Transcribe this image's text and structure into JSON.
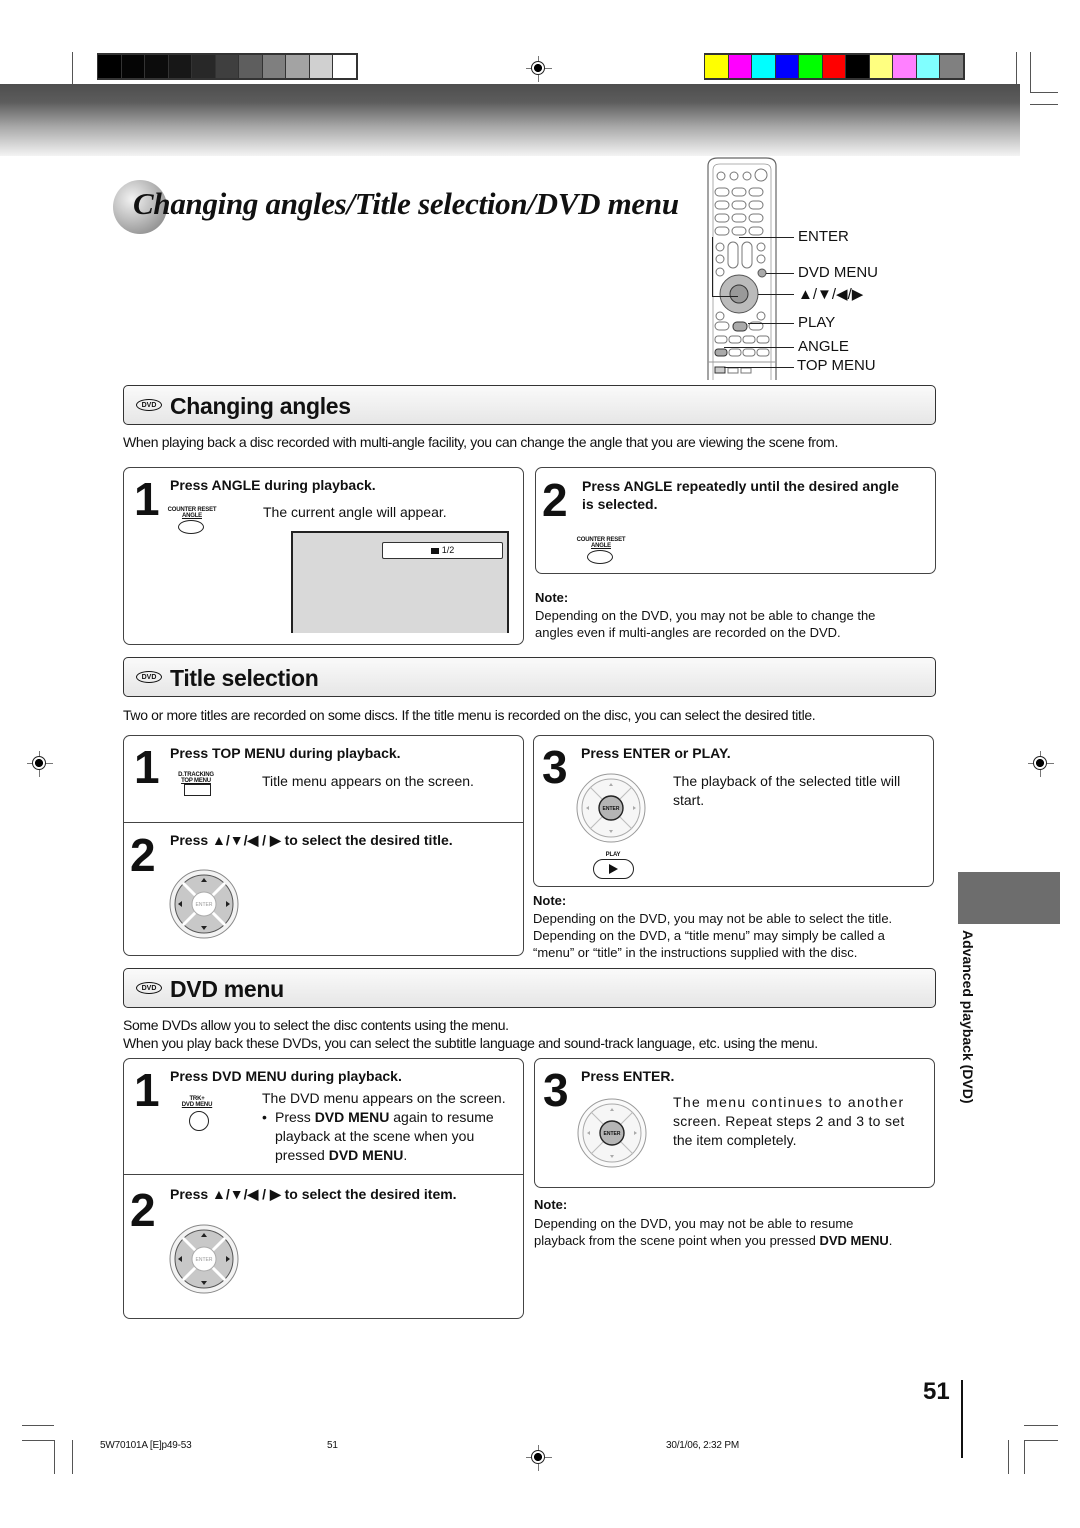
{
  "registration": {
    "gray_swatches": [
      "#000000",
      "#050505",
      "#0c0c0c",
      "#171717",
      "#282828",
      "#3f3f3f",
      "#5e5e5e",
      "#7f7f7f",
      "#a3a3a3",
      "#d0d0d0",
      "#ffffff"
    ],
    "color_swatches": [
      "#ffff00",
      "#ff00ff",
      "#00ffff",
      "#0000ff",
      "#00ff00",
      "#ff0000",
      "#000000",
      "#ffff80",
      "#ff80ff",
      "#80ffff",
      "#808080"
    ]
  },
  "page": {
    "title": "Changing angles/Title selection/DVD menu",
    "page_number": "51",
    "side_tab": "Advanced playback (DVD)"
  },
  "remote_labels": [
    "ENTER",
    "DVD MENU",
    "▲/▼/◀/▶",
    "PLAY",
    "ANGLE",
    "TOP MENU"
  ],
  "sections": {
    "angles": {
      "badge": "DVD",
      "title": "Changing angles",
      "intro": "When playing back a disc recorded with multi-angle facility, you can change the angle that you are viewing the scene from.",
      "step1": {
        "num": "1",
        "head": "Press ANGLE during playback.",
        "button_label_top": "COUNTER RESET",
        "button_label_bottom": "ANGLE",
        "text": "The current angle will appear.",
        "osd": "1/2"
      },
      "step2": {
        "num": "2",
        "head_line1": "Press ANGLE repeatedly until the desired angle",
        "head_line2": "is selected.",
        "button_label_top": "COUNTER RESET",
        "button_label_bottom": "ANGLE"
      },
      "note_heading": "Note:",
      "note_lines": [
        "Depending on the DVD, you may not be able to change the",
        "angles even if multi-angles are recorded on the DVD."
      ]
    },
    "title_selection": {
      "badge": "DVD",
      "title": "Title selection",
      "intro": "Two or more titles are recorded on some discs. If the title menu is recorded on the disc, you can select the desired title.",
      "step1": {
        "num": "1",
        "head": "Press TOP MENU during playback.",
        "button_label_top": "D.TRACKING",
        "button_label_bottom": "TOP MENU",
        "text": "Title menu appears on the screen."
      },
      "step2": {
        "num": "2",
        "head": "Press ▲/▼/◀ / ▶ to select the desired title.",
        "pad_label": "ENTER"
      },
      "step3": {
        "num": "3",
        "head": "Press ENTER or PLAY.",
        "pad_label": "ENTER",
        "play_label": "PLAY",
        "text_line1": "The playback of the selected title will",
        "text_line2": "start."
      },
      "note_heading": "Note:",
      "note_lines": [
        "Depending on the DVD, you may not be able to select the title.",
        "Depending on the DVD, a “title menu” may simply be called a",
        "“menu” or “title” in the instructions supplied with the disc."
      ]
    },
    "dvd_menu": {
      "badge": "DVD",
      "title": "DVD menu",
      "intro_lines": [
        "Some DVDs allow you to select the disc contents using the menu.",
        "When you play back these DVDs, you can select the subtitle language and sound-track language, etc. using the menu."
      ],
      "step1": {
        "num": "1",
        "head": "Press DVD MENU during playback.",
        "button_label_top": "TRK+",
        "button_label_bottom": "DVD MENU",
        "text": "The DVD menu appears on the screen.",
        "bullet_pre": "Press ",
        "bullet_bold": "DVD MENU",
        "bullet_post": " again to resume",
        "bullet_line2": "playback at the scene when you",
        "bullet_line3_pre": "pressed ",
        "bullet_line3_bold": "DVD MENU",
        "bullet_line3_post": "."
      },
      "step2": {
        "num": "2",
        "head": "Press ▲/▼/◀ / ▶ to select the desired item.",
        "pad_label": "ENTER"
      },
      "step3": {
        "num": "3",
        "head": "Press ENTER.",
        "pad_label": "ENTER",
        "text_line1": "The menu continues to another",
        "text_line2": "screen. Repeat steps 2 and 3 to set",
        "text_line3": "the item completely."
      },
      "note_heading": "Note:",
      "note_line1": "Depending on the DVD, you may not be able to resume",
      "note_line2_pre": "playback from the scene point when you pressed ",
      "note_line2_bold": "DVD MENU",
      "note_line2_post": "."
    }
  },
  "footer": {
    "file": "5W70101A [E]p49-53",
    "page": "51",
    "datetime": "30/1/06, 2:32 PM"
  }
}
